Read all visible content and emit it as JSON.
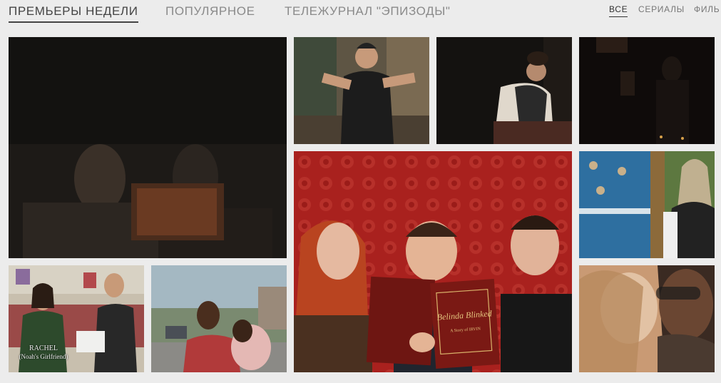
{
  "nav": {
    "tabs": [
      {
        "label": "ПРЕМЬЕРЫ НЕДЕЛИ"
      },
      {
        "label": "ПОПУЛЯРНОЕ"
      },
      {
        "label": "ТЕЛЕЖУРНАЛ \"ЭПИЗОДЫ\""
      }
    ],
    "filters": [
      {
        "label": "ВСЕ"
      },
      {
        "label": "СЕРИАЛЫ"
      },
      {
        "label": "ФИЛЬ"
      }
    ]
  },
  "tiles": {
    "belinda": {
      "book_title": "Belinda Blinked",
      "book_subtitle": "A Story of IRVIN"
    },
    "rachel": {
      "name": "RACHEL",
      "role": "(Noah's Girlfriend)"
    }
  }
}
